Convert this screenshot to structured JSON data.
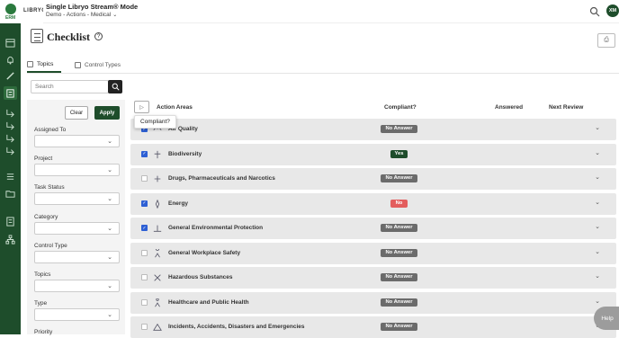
{
  "brand": {
    "logo_text": "ERM",
    "product": "LIBRYO"
  },
  "topbar": {
    "mode_title": "Single Libryo Stream® Mode",
    "stream_name": "Demo - Actions - Medical",
    "avatar_initials": "XM"
  },
  "page": {
    "title": "Checklist",
    "help": "?"
  },
  "tabs": [
    {
      "label": "Topics"
    },
    {
      "label": "Control Types"
    }
  ],
  "search": {
    "placeholder": "Search"
  },
  "filters": {
    "clear_label": "Clear",
    "apply_label": "Apply",
    "fields": [
      {
        "label": "Assigned To"
      },
      {
        "label": "Project"
      },
      {
        "label": "Task Status"
      },
      {
        "label": "Category"
      },
      {
        "label": "Control Type"
      },
      {
        "label": "Topics"
      },
      {
        "label": "Type"
      },
      {
        "label": "Priority"
      }
    ]
  },
  "list": {
    "columns": {
      "action_areas": "Action Areas",
      "compliant": "Compliant?",
      "answered": "Answered",
      "next_review": "Next Review"
    },
    "tooltip": "Compliant?",
    "rows": [
      {
        "name": "Air Quality",
        "checked": true,
        "status": "No Answer",
        "status_type": "na"
      },
      {
        "name": "Biodiversity",
        "checked": true,
        "status": "Yes",
        "status_type": "yes"
      },
      {
        "name": "Drugs, Pharmaceuticals and Narcotics",
        "checked": false,
        "status": "No Answer",
        "status_type": "na"
      },
      {
        "name": "Energy",
        "checked": true,
        "status": "No",
        "status_type": "no"
      },
      {
        "name": "General Environmental Protection",
        "checked": true,
        "status": "No Answer",
        "status_type": "na"
      },
      {
        "name": "General Workplace Safety",
        "checked": false,
        "status": "No Answer",
        "status_type": "na"
      },
      {
        "name": "Hazardous Substances",
        "checked": false,
        "status": "No Answer",
        "status_type": "na"
      },
      {
        "name": "Healthcare and Public Health",
        "checked": false,
        "status": "No Answer",
        "status_type": "na"
      },
      {
        "name": "Incidents, Accidents, Disasters and Emergencies",
        "checked": false,
        "status": "No Answer",
        "status_type": "na"
      }
    ]
  },
  "help_fab": {
    "label": "Help"
  },
  "colors": {
    "brand_green": "#1e4d2b",
    "yes": "#1e4d2b",
    "no": "#e35d5d",
    "no_answer": "#6b6b6b",
    "checkbox": "#2d5fd4"
  }
}
